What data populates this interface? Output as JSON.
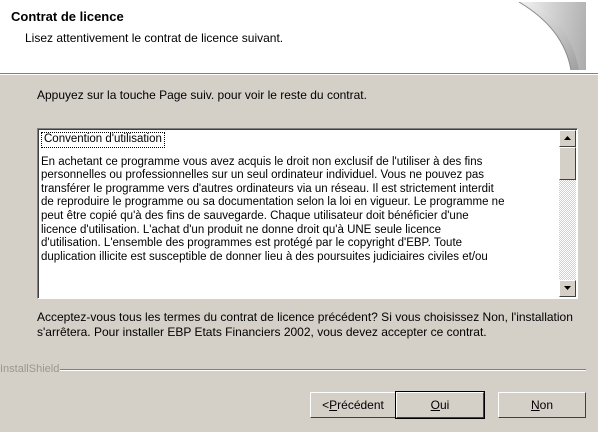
{
  "header": {
    "title": "Contrat de licence",
    "subtitle": "Lisez attentivement le contrat de licence suivant."
  },
  "instruction": "Appuyez sur la touche Page suiv. pour voir le reste du contrat.",
  "license": {
    "heading": "Convention d'utilisation",
    "body": "En achetant ce programme vous avez acquis le droit non exclusif de l'utiliser à des fins\npersonnelles ou professionnelles sur un seul ordinateur individuel. Vous ne pouvez pas\ntransférer le programme vers d'autres ordinateurs via un réseau. Il est strictement interdit\nde reproduire le programme ou sa documentation selon la loi en vigueur. Le programme ne\npeut être copié qu'à des fins de sauvegarde. Chaque utilisateur doit bénéficier d'une\nlicence d'utilisation. L'achat d'un produit ne donne droit qu'à UNE seule licence\nd'utilisation. L'ensemble des programmes est protégé par le copyright d'EBP. Toute\nduplication illicite est susceptible de donner lieu à des poursuites judiciaires civiles et/ou"
  },
  "question": "Acceptez-vous tous les termes du contrat de licence précédent?  Si vous choisissez Non, l'installation s'arrêtera.  Pour installer EBP Etats Financiers 2002, vous devez accepter ce contrat.",
  "brand": "InstallShield",
  "buttons": {
    "back_prefix": "< ",
    "back_accel": "P",
    "back_rest": "récédent",
    "yes_accel": "O",
    "yes_rest": "ui",
    "no_accel": "N",
    "no_rest": "on"
  },
  "colors": {
    "dialog_bg": "#d4d0c8",
    "header_bg": "#ffffff",
    "brand_text": "#9a978f"
  }
}
